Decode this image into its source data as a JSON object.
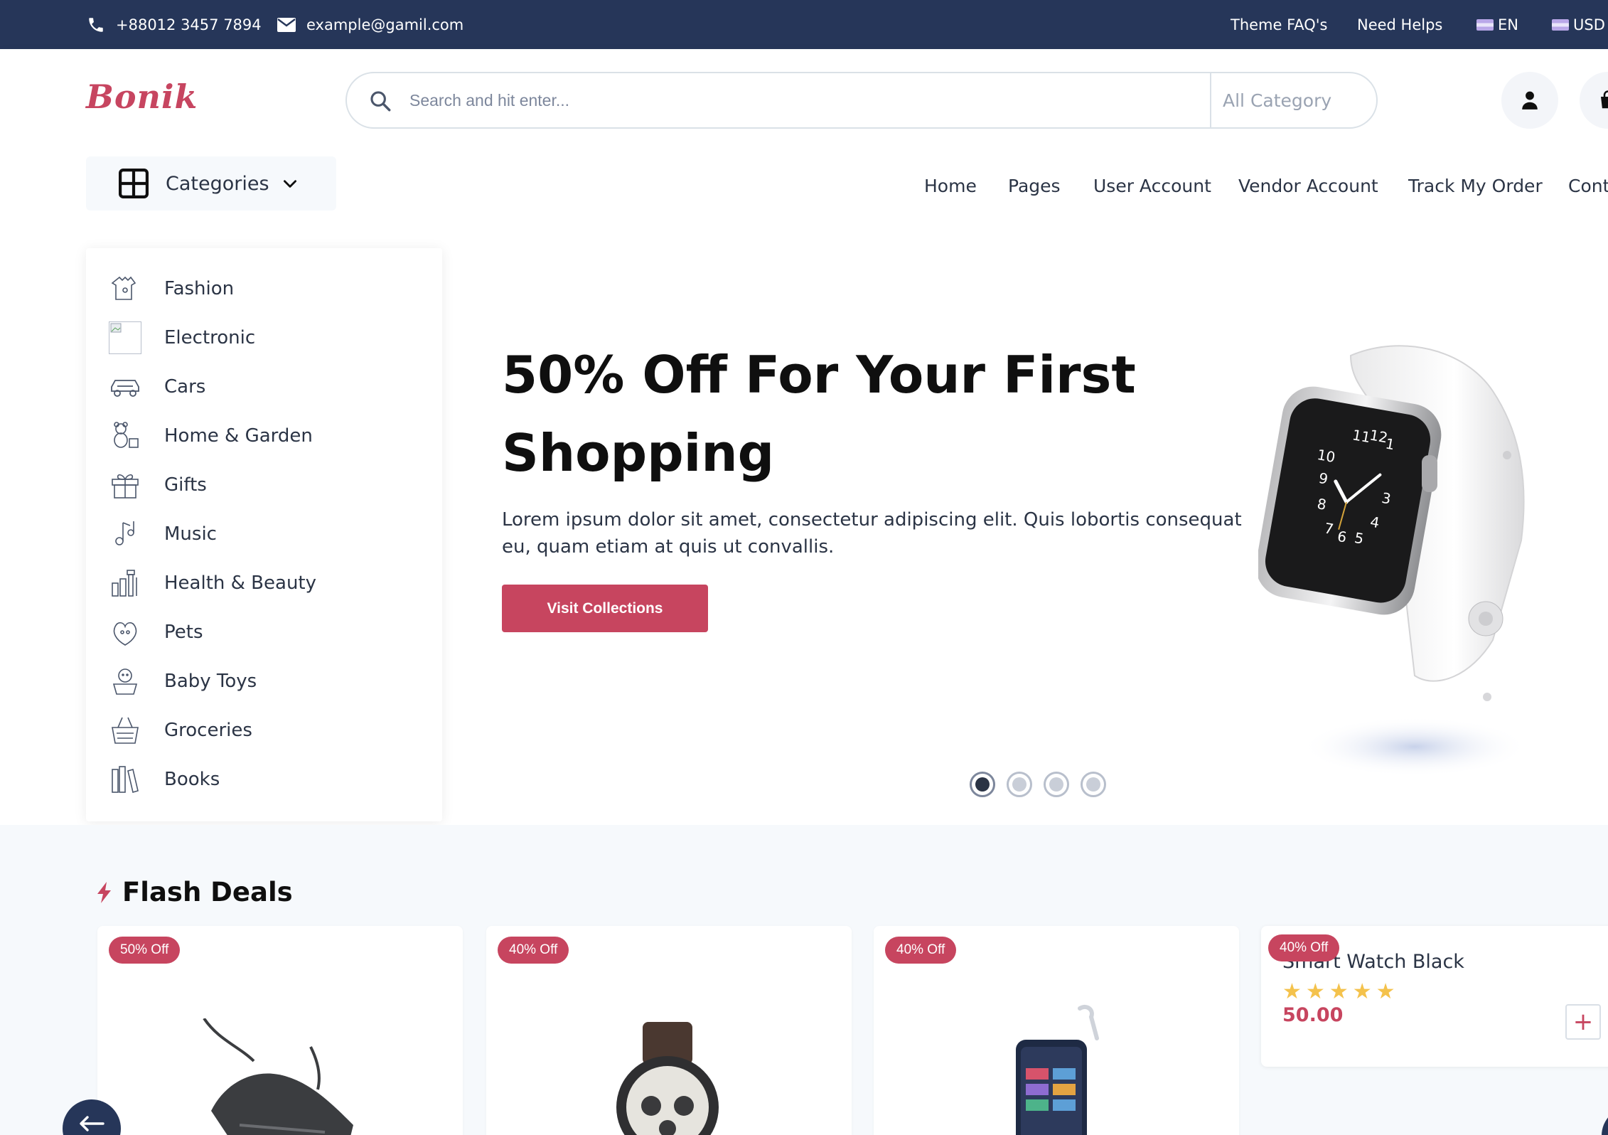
{
  "topbar": {
    "phone": "+88012 3457 7894",
    "email": "example@gamil.com",
    "links": [
      "Theme FAQ's",
      "Need Helps"
    ],
    "language": "EN",
    "currency": "USD"
  },
  "header": {
    "logo": "Bonik",
    "search": {
      "placeholder": "Search and hit enter...",
      "category": "All Category"
    },
    "categories_label": "Categories",
    "nav": [
      "Home",
      "Pages",
      "User Account",
      "Vendor Account",
      "Track My Order",
      "Cont"
    ]
  },
  "sidebar": {
    "items": [
      {
        "label": "Fashion",
        "icon": "dress-icon"
      },
      {
        "label": "Electronic",
        "icon": "broken-image-icon"
      },
      {
        "label": "Cars",
        "icon": "car-icon"
      },
      {
        "label": "Home & Garden",
        "icon": "teddy-bear-icon"
      },
      {
        "label": "Gifts",
        "icon": "gift-icon"
      },
      {
        "label": "Music",
        "icon": "music-icon"
      },
      {
        "label": "Health & Beauty",
        "icon": "beauty-icon"
      },
      {
        "label": "Pets",
        "icon": "pet-icon"
      },
      {
        "label": "Baby Toys",
        "icon": "baby-icon"
      },
      {
        "label": "Groceries",
        "icon": "basket-icon"
      },
      {
        "label": "Books",
        "icon": "books-icon"
      }
    ]
  },
  "hero": {
    "title": "50% Off For Your First Shopping",
    "description": "Lorem ipsum dolor sit amet, consectetur adipiscing elit. Quis lobortis consequat eu, quam etiam at quis ut convallis.",
    "button": "Visit Collections",
    "slides": 4,
    "active_slide": 1
  },
  "flash_deals": {
    "title": "Flash Deals",
    "cards": [
      {
        "badge": "50% Off",
        "product_icon": "sneaker-icon"
      },
      {
        "badge": "40% Off",
        "product_icon": "wristwatch-icon"
      },
      {
        "badge": "40% Off",
        "product_icon": "phone-icon"
      },
      {
        "badge": "40% Off",
        "name": "Smart Watch Black",
        "rating": 5,
        "price": "50.00"
      }
    ]
  },
  "colors": {
    "primary": "#c7455f",
    "navy": "#263659",
    "text": "#2b3445"
  }
}
